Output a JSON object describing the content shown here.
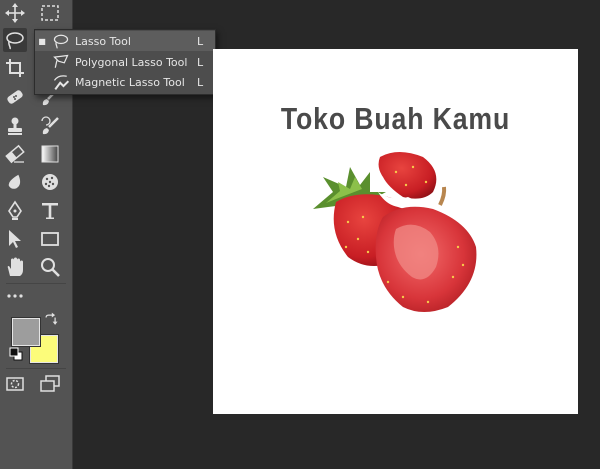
{
  "flyout": {
    "items": [
      {
        "label": "Lasso Tool",
        "shortcut": "L",
        "selected": true,
        "icon": "lasso-icon"
      },
      {
        "label": "Polygonal Lasso Tool",
        "shortcut": "L",
        "selected": false,
        "icon": "polygonal-lasso-icon"
      },
      {
        "label": "Magnetic Lasso Tool",
        "shortcut": "L",
        "selected": false,
        "icon": "magnetic-lasso-icon"
      }
    ]
  },
  "toolbar": {
    "tools": [
      "move-icon",
      "rectangular-marquee-icon",
      "lasso-icon",
      "crop-icon",
      "spot-healing-brush-icon",
      "brush-icon",
      "clone-stamp-icon",
      "history-brush-icon",
      "eraser-icon",
      "gradient-icon",
      "blur-icon",
      "sponge-icon",
      "pen-icon",
      "type-icon",
      "path-selection-icon",
      "rectangle-shape-icon",
      "hand-icon",
      "zoom-icon",
      "more-tools-icon",
      "swap-colors-icon",
      "default-colors-icon",
      "quick-mask-icon",
      "screen-mode-icon"
    ]
  },
  "colors": {
    "foreground": "#9d9d9d",
    "background": "#fcfc7a",
    "workspace": "#282828",
    "toolbar": "#535353"
  },
  "document": {
    "title": "Toko Buah Kamu"
  }
}
